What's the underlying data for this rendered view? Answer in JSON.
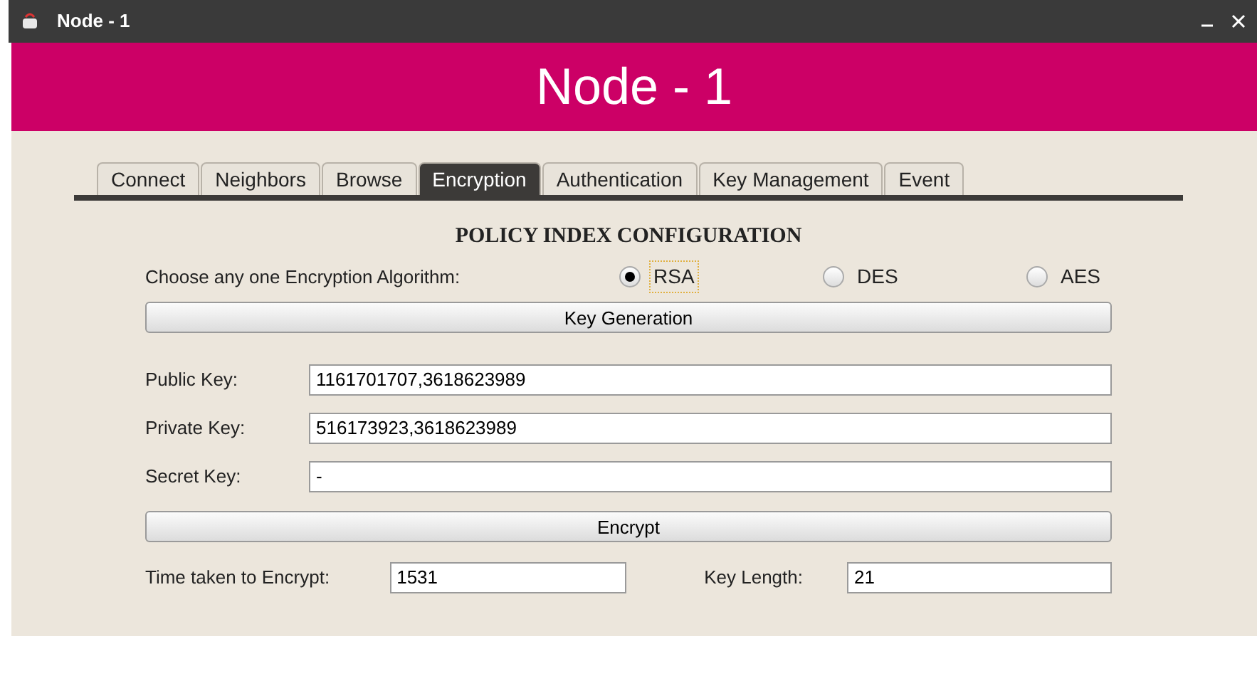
{
  "window": {
    "title": "Node - 1"
  },
  "banner": {
    "title": "Node - 1"
  },
  "tabs": [
    {
      "label": "Connect",
      "selected": false
    },
    {
      "label": "Neighbors",
      "selected": false
    },
    {
      "label": "Browse",
      "selected": false
    },
    {
      "label": "Encryption",
      "selected": true
    },
    {
      "label": "Authentication",
      "selected": false
    },
    {
      "label": "Key Management",
      "selected": false
    },
    {
      "label": "Event",
      "selected": false
    }
  ],
  "section_title": "POLICY INDEX CONFIGURATION",
  "algorithm": {
    "label": "Choose any one Encryption Algorithm:",
    "options": [
      {
        "label": "RSA",
        "selected": true
      },
      {
        "label": "DES",
        "selected": false
      },
      {
        "label": "AES",
        "selected": false
      }
    ]
  },
  "key_generation_button": "Key Generation",
  "key_fields": [
    {
      "label": "Public Key:",
      "value": "1161701707,3618623989"
    },
    {
      "label": "Private Key:",
      "value": "516173923,3618623989"
    },
    {
      "label": "Secret Key:",
      "value": "-"
    }
  ],
  "encrypt_button": "Encrypt",
  "time_taken": {
    "label": "Time taken to Encrypt:",
    "value": "1531"
  },
  "key_length": {
    "label": "Key Length:",
    "value": "21"
  }
}
